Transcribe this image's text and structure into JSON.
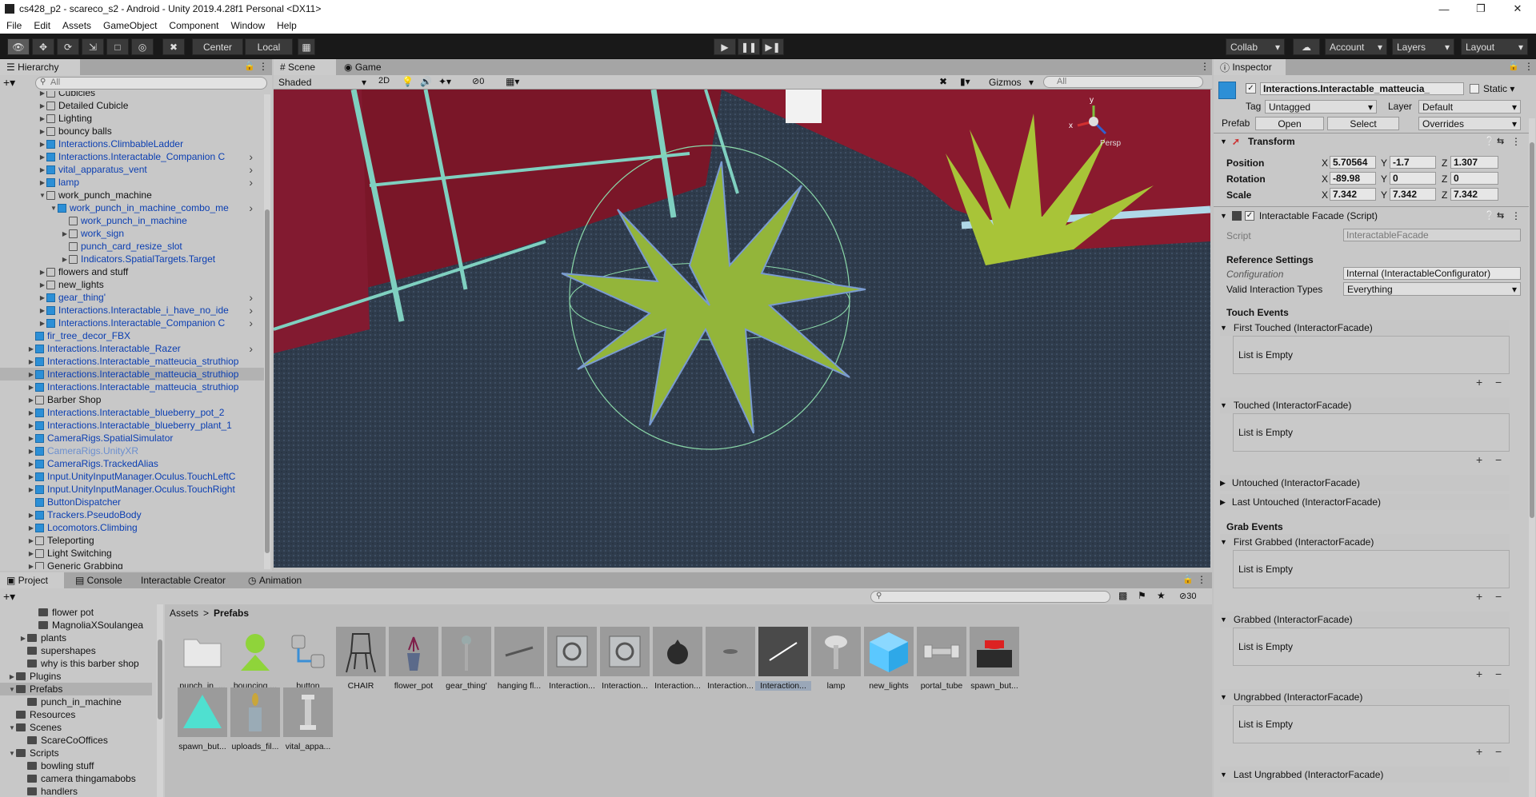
{
  "window": {
    "title": "cs428_p2 - scareco_s2 - Android - Unity 2019.4.28f1 Personal <DX11>"
  },
  "menu": [
    "File",
    "Edit",
    "Assets",
    "GameObject",
    "Component",
    "Window",
    "Help"
  ],
  "toolbar": {
    "center": "Center",
    "local": "Local",
    "collab": "Collab",
    "account": "Account",
    "layers": "Layers",
    "layout": "Layout"
  },
  "hierarchy": {
    "tab": "Hierarchy",
    "search_placeholder": "All",
    "rows": [
      {
        "label": "Cubicles",
        "indent": 4,
        "color": "black",
        "icon": "gray",
        "expand": "right"
      },
      {
        "label": "Detailed Cubicle",
        "indent": 4,
        "color": "black",
        "icon": "gray",
        "expand": "right"
      },
      {
        "label": "Lighting",
        "indent": 4,
        "color": "black",
        "icon": "gray",
        "expand": "right"
      },
      {
        "label": "bouncy balls",
        "indent": 4,
        "color": "black",
        "icon": "gray",
        "expand": "right"
      },
      {
        "label": "Interactions.ClimbableLadder",
        "indent": 4,
        "color": "blue",
        "icon": "blue",
        "expand": "right"
      },
      {
        "label": "Interactions.Interactable_Companion C",
        "indent": 4,
        "color": "blue",
        "icon": "blue",
        "expand": "right",
        "more": true
      },
      {
        "label": "vital_apparatus_vent",
        "indent": 4,
        "color": "blue",
        "icon": "blue",
        "expand": "right",
        "more": true
      },
      {
        "label": "lamp",
        "indent": 4,
        "color": "blue",
        "icon": "blue",
        "expand": "right",
        "more": true
      },
      {
        "label": "work_punch_machine",
        "indent": 4,
        "color": "black",
        "icon": "gray",
        "expand": "down"
      },
      {
        "label": "work_punch_in_machine_combo_me",
        "indent": 5,
        "color": "blue",
        "icon": "blue",
        "expand": "down",
        "more": true
      },
      {
        "label": "work_punch_in_machine",
        "indent": 6,
        "color": "blue",
        "icon": "gray",
        "expand": ""
      },
      {
        "label": "work_sign",
        "indent": 6,
        "color": "blue",
        "icon": "gray",
        "expand": "right"
      },
      {
        "label": "punch_card_resize_slot",
        "indent": 6,
        "color": "blue",
        "icon": "gray",
        "expand": ""
      },
      {
        "label": "Indicators.SpatialTargets.Target",
        "indent": 6,
        "color": "blue",
        "icon": "gray",
        "expand": "right"
      },
      {
        "label": "flowers and stuff",
        "indent": 4,
        "color": "black",
        "icon": "gray",
        "expand": "right"
      },
      {
        "label": "new_lights",
        "indent": 4,
        "color": "black",
        "icon": "gray",
        "expand": "right"
      },
      {
        "label": "gear_thing'",
        "indent": 4,
        "color": "blue",
        "icon": "blue",
        "expand": "right",
        "more": true
      },
      {
        "label": "Interactions.Interactable_i_have_no_ide",
        "indent": 4,
        "color": "blue",
        "icon": "blue",
        "expand": "right",
        "more": true
      },
      {
        "label": "Interactions.Interactable_Companion C",
        "indent": 4,
        "color": "blue",
        "icon": "blue",
        "expand": "right",
        "more": true
      },
      {
        "label": "fir_tree_decor_FBX",
        "indent": 3,
        "color": "blue",
        "icon": "blue",
        "expand": ""
      },
      {
        "label": "Interactions.Interactable_Razer",
        "indent": 3,
        "color": "blue",
        "icon": "blue",
        "expand": "right",
        "more": true
      },
      {
        "label": "Interactions.Interactable_matteucia_struthiop",
        "indent": 3,
        "color": "blue",
        "icon": "blue",
        "expand": "right"
      },
      {
        "label": "Interactions.Interactable_matteucia_struthiop",
        "indent": 3,
        "color": "blue",
        "icon": "blue",
        "expand": "right",
        "selected": true
      },
      {
        "label": "Interactions.Interactable_matteucia_struthiop",
        "indent": 3,
        "color": "blue",
        "icon": "blue",
        "expand": "right"
      },
      {
        "label": "Barber Shop",
        "indent": 3,
        "color": "black",
        "icon": "gray",
        "expand": "right"
      },
      {
        "label": "Interactions.Interactable_blueberry_pot_2",
        "indent": 3,
        "color": "blue",
        "icon": "blue",
        "expand": "right"
      },
      {
        "label": "Interactions.Interactable_blueberry_plant_1",
        "indent": 3,
        "color": "blue",
        "icon": "blue",
        "expand": "right"
      },
      {
        "label": "CameraRigs.SpatialSimulator",
        "indent": 3,
        "color": "blue",
        "icon": "blue",
        "expand": "right"
      },
      {
        "label": "CameraRigs.UnityXR",
        "indent": 3,
        "color": "faded",
        "icon": "blue",
        "expand": "right"
      },
      {
        "label": "CameraRigs.TrackedAlias",
        "indent": 3,
        "color": "blue",
        "icon": "blue",
        "expand": "right"
      },
      {
        "label": "Input.UnityInputManager.Oculus.TouchLeftC",
        "indent": 3,
        "color": "blue",
        "icon": "blue",
        "expand": "right"
      },
      {
        "label": "Input.UnityInputManager.Oculus.TouchRight",
        "indent": 3,
        "color": "blue",
        "icon": "blue",
        "expand": "right"
      },
      {
        "label": "ButtonDispatcher",
        "indent": 3,
        "color": "blue",
        "icon": "blue",
        "expand": ""
      },
      {
        "label": "Trackers.PseudoBody",
        "indent": 3,
        "color": "blue",
        "icon": "blue",
        "expand": "right"
      },
      {
        "label": "Locomotors.Climbing",
        "indent": 3,
        "color": "blue",
        "icon": "blue",
        "expand": "right"
      },
      {
        "label": "Teleporting",
        "indent": 3,
        "color": "black",
        "icon": "gray",
        "expand": "right"
      },
      {
        "label": "Light Switching",
        "indent": 3,
        "color": "black",
        "icon": "gray",
        "expand": "right"
      },
      {
        "label": "Generic Grabbing",
        "indent": 3,
        "color": "black",
        "icon": "gray",
        "expand": "right"
      }
    ]
  },
  "scene": {
    "tab_scene": "Scene",
    "tab_game": "Game",
    "shading": "Shaded",
    "mode2d": "2D",
    "hidden_count": "0",
    "gizmos": "Gizmos",
    "search_placeholder": "All",
    "persp": "Persp"
  },
  "inspector": {
    "tab": "Inspector",
    "object_name": "Interactions.Interactable_matteucia_",
    "static": "Static",
    "tag_label": "Tag",
    "tag": "Untagged",
    "layer_label": "Layer",
    "layer": "Default",
    "prefab_label": "Prefab",
    "open": "Open",
    "select": "Select",
    "overrides": "Overrides",
    "transform": {
      "title": "Transform",
      "position": {
        "label": "Position",
        "x": "5.70564",
        "y": "-1.7",
        "z": "1.307"
      },
      "rotation": {
        "label": "Rotation",
        "x": "-89.98",
        "y": "0",
        "z": "0"
      },
      "scale": {
        "label": "Scale",
        "x": "7.342",
        "y": "7.342",
        "z": "7.342"
      }
    },
    "component": {
      "title": "Interactable Facade (Script)",
      "script_label": "Script",
      "script": "InteractableFacade",
      "ref_settings": "Reference Settings",
      "config_label": "Configuration",
      "config": "Internal (InteractableConfigurator)",
      "valid_label": "Valid Interaction Types",
      "valid": "Everything",
      "touch_events": "Touch Events",
      "grab_events": "Grab Events",
      "empty": "List is Empty",
      "first_touched": "First Touched (InteractorFacade)",
      "touched": "Touched (InteractorFacade)",
      "untouched": "Untouched (InteractorFacade)",
      "last_untouched": "Last Untouched (InteractorFacade)",
      "first_grabbed": "First Grabbed (InteractorFacade)",
      "grabbed": "Grabbed (InteractorFacade)",
      "ungrabbed": "Ungrabbed (InteractorFacade)",
      "last_ungrabbed": "Last Ungrabbed (InteractorFacade)"
    }
  },
  "bottom": {
    "tabs": [
      "Project",
      "Console",
      "Interactable Creator",
      "Animation"
    ],
    "hidden_count": "30",
    "breadcrumb": [
      "Assets",
      "Prefabs"
    ],
    "tree": [
      {
        "label": "flower pot",
        "indent": 3,
        "expand": ""
      },
      {
        "label": "MagnoliaXSoulangea",
        "indent": 3,
        "expand": ""
      },
      {
        "label": "plants",
        "indent": 2,
        "expand": "right"
      },
      {
        "label": "supershapes",
        "indent": 2,
        "expand": ""
      },
      {
        "label": "why is this barber shop",
        "indent": 2,
        "expand": ""
      },
      {
        "label": "Plugins",
        "indent": 1,
        "expand": "right"
      },
      {
        "label": "Prefabs",
        "indent": 1,
        "expand": "down",
        "selected": true
      },
      {
        "label": "punch_in_machine",
        "indent": 2,
        "expand": ""
      },
      {
        "label": "Resources",
        "indent": 1,
        "expand": ""
      },
      {
        "label": "Scenes",
        "indent": 1,
        "expand": "down"
      },
      {
        "label": "ScareCoOffices",
        "indent": 2,
        "expand": ""
      },
      {
        "label": "Scripts",
        "indent": 1,
        "expand": "down"
      },
      {
        "label": "bowling stuff",
        "indent": 2,
        "expand": ""
      },
      {
        "label": "camera thingamabobs",
        "indent": 2,
        "expand": ""
      },
      {
        "label": "handlers",
        "indent": 2,
        "expand": ""
      }
    ],
    "assets": [
      {
        "label": "punch_in_...",
        "kind": "folder"
      },
      {
        "label": "bouncing ...",
        "kind": "bounce"
      },
      {
        "label": "button",
        "kind": "button"
      },
      {
        "label": "CHAIR",
        "kind": "chair"
      },
      {
        "label": "flower_pot",
        "kind": "pot"
      },
      {
        "label": "gear_thing'",
        "kind": "gear"
      },
      {
        "label": "hanging fl...",
        "kind": "hanging"
      },
      {
        "label": "Interaction...",
        "kind": "cube"
      },
      {
        "label": "Interaction...",
        "kind": "cube"
      },
      {
        "label": "Interaction...",
        "kind": "ball"
      },
      {
        "label": "Interaction...",
        "kind": "flat"
      },
      {
        "label": "Interaction...",
        "kind": "line",
        "selected": true
      },
      {
        "label": "lamp",
        "kind": "lamp"
      },
      {
        "label": "new_lights",
        "kind": "bluecube"
      },
      {
        "label": "portal_tube",
        "kind": "tube"
      },
      {
        "label": "spawn_but...",
        "kind": "redbtn"
      },
      {
        "label": "spawn_but...",
        "kind": "tri"
      },
      {
        "label": "uploads_fil...",
        "kind": "vase"
      },
      {
        "label": "vital_appa...",
        "kind": "vital"
      }
    ]
  }
}
